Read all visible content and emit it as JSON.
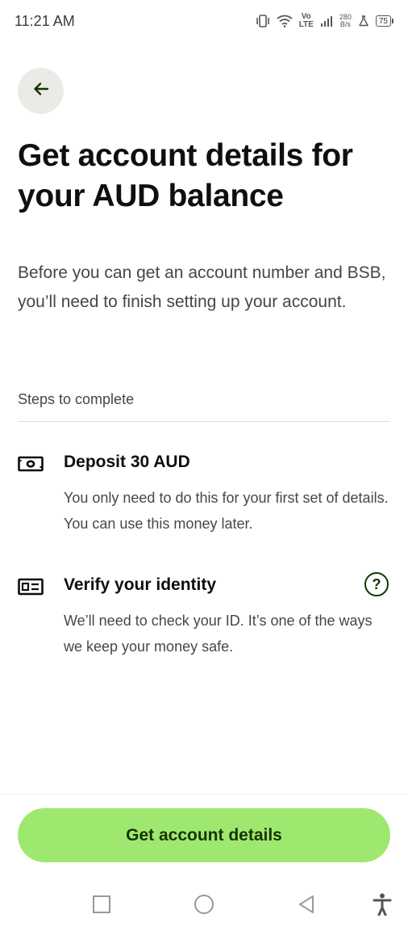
{
  "status_bar": {
    "time": "11:21 AM",
    "volte_top": "Vo",
    "volte_bottom": "LTE",
    "speed_value": "280",
    "speed_unit": "B/s",
    "battery": "75"
  },
  "page": {
    "title": "Get account details for your AUD balance",
    "intro": "Before you can get an account number and BSB, you’ll need to finish setting up your account.",
    "steps_label": "Steps to complete"
  },
  "steps": [
    {
      "icon": "banknote-icon",
      "title": "Deposit 30 AUD",
      "description": "You only need to do this for your first set of details. You can use this money later."
    },
    {
      "icon": "id-card-icon",
      "title": "Verify your identity",
      "description": "We’ll need to check your ID. It’s one of the ways we keep your money safe.",
      "help_glyph": "?"
    }
  ],
  "cta": {
    "label": "Get account details"
  },
  "colors": {
    "accent": "#9fe870",
    "accent_text": "#163300",
    "back_bg": "#e8ebe6"
  }
}
